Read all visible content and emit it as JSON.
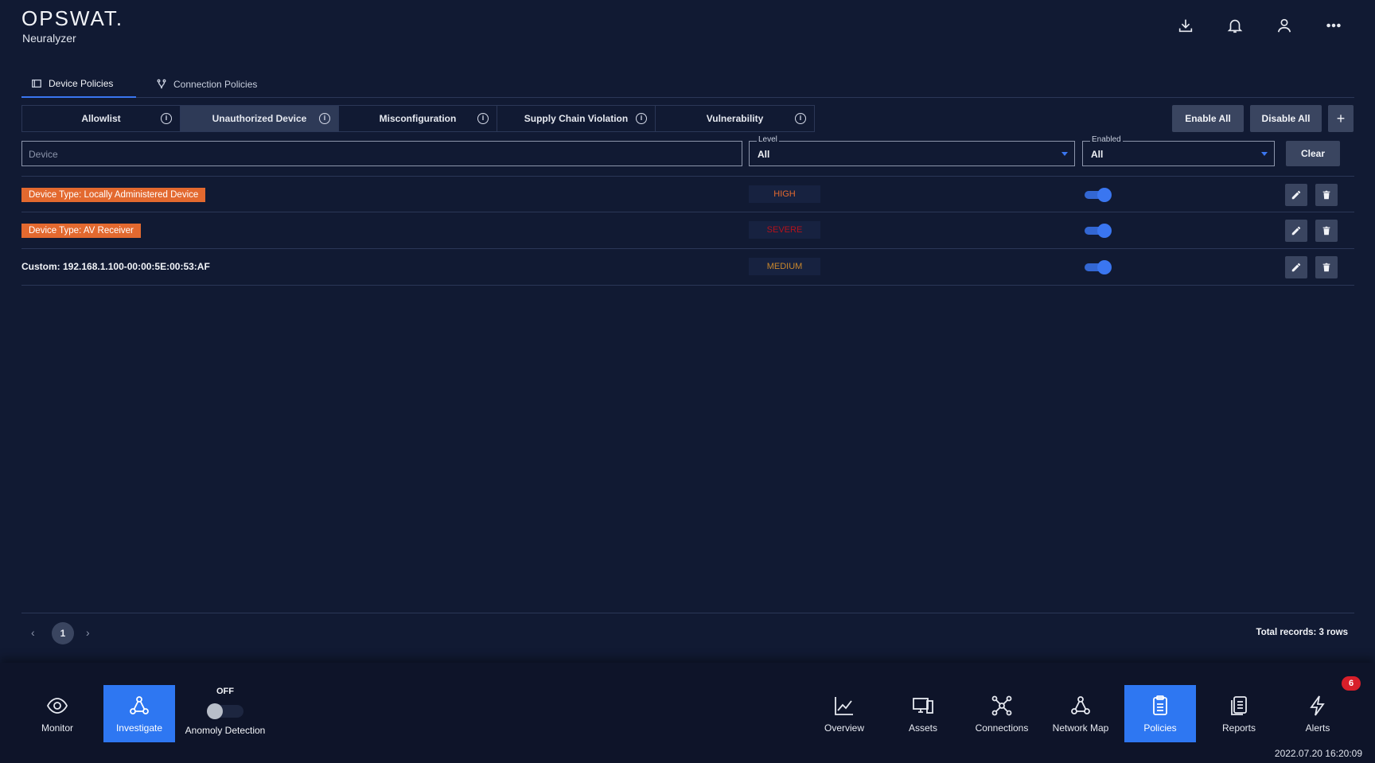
{
  "app": {
    "logo": "OPSWAT.",
    "subtitle": "Neuralyzer"
  },
  "header_icons": [
    "download-icon",
    "bell-icon",
    "user-icon",
    "more-icon"
  ],
  "tabs": [
    {
      "label": "Device Policies",
      "active": true,
      "icon": "device-icon"
    },
    {
      "label": "Connection Policies",
      "active": false,
      "icon": "fork-icon"
    }
  ],
  "subtabs": [
    {
      "label": "Allowlist",
      "active": false
    },
    {
      "label": "Unauthorized Device",
      "active": true
    },
    {
      "label": "Misconfiguration",
      "active": false
    },
    {
      "label": "Supply Chain Violation",
      "active": false
    },
    {
      "label": "Vulnerability",
      "active": false
    }
  ],
  "actions": {
    "enable_all": "Enable All",
    "disable_all": "Disable All",
    "add": "+"
  },
  "filters": {
    "device_placeholder": "Device",
    "level_label": "Level",
    "level_value": "All",
    "enabled_label": "Enabled",
    "enabled_value": "All",
    "clear": "Clear"
  },
  "rows": [
    {
      "name": "Device Type: Locally Administered Device",
      "tagged": true,
      "level": "HIGH",
      "level_color": "#e3692f",
      "enabled": true
    },
    {
      "name": "Device Type: AV Receiver",
      "tagged": true,
      "level": "SEVERE",
      "level_color": "#b5121b",
      "enabled": true
    },
    {
      "name": "Custom: 192.168.1.100-00:00:5E:00:53:AF",
      "tagged": false,
      "level": "MEDIUM",
      "level_color": "#c9872c",
      "enabled": true
    }
  ],
  "pagination": {
    "prev": "‹",
    "current": "1",
    "next": "›",
    "total": "Total records: 3 rows"
  },
  "footer": {
    "left_nav": [
      {
        "label": "Monitor",
        "icon": "eye-icon",
        "active": false
      },
      {
        "label": "Investigate",
        "icon": "network-icon",
        "active": true
      }
    ],
    "anomaly": {
      "state": "OFF",
      "label": "Anomoly Detection"
    },
    "right_nav": [
      {
        "label": "Overview",
        "icon": "chart-icon",
        "active": false
      },
      {
        "label": "Assets",
        "icon": "assets-icon",
        "active": false
      },
      {
        "label": "Connections",
        "icon": "connections-icon",
        "active": false
      },
      {
        "label": "Network Map",
        "icon": "network-map-icon",
        "active": false
      },
      {
        "label": "Policies",
        "icon": "clipboard-icon",
        "active": true
      },
      {
        "label": "Reports",
        "icon": "reports-icon",
        "active": false
      },
      {
        "label": "Alerts",
        "icon": "lightning-icon",
        "active": false
      }
    ],
    "alerts_badge": "6",
    "timestamp": "2022.07.20 16:20:09"
  },
  "colors": {
    "accent": "#3a76f0",
    "tag": "#e3692f",
    "background": "#111a33"
  }
}
